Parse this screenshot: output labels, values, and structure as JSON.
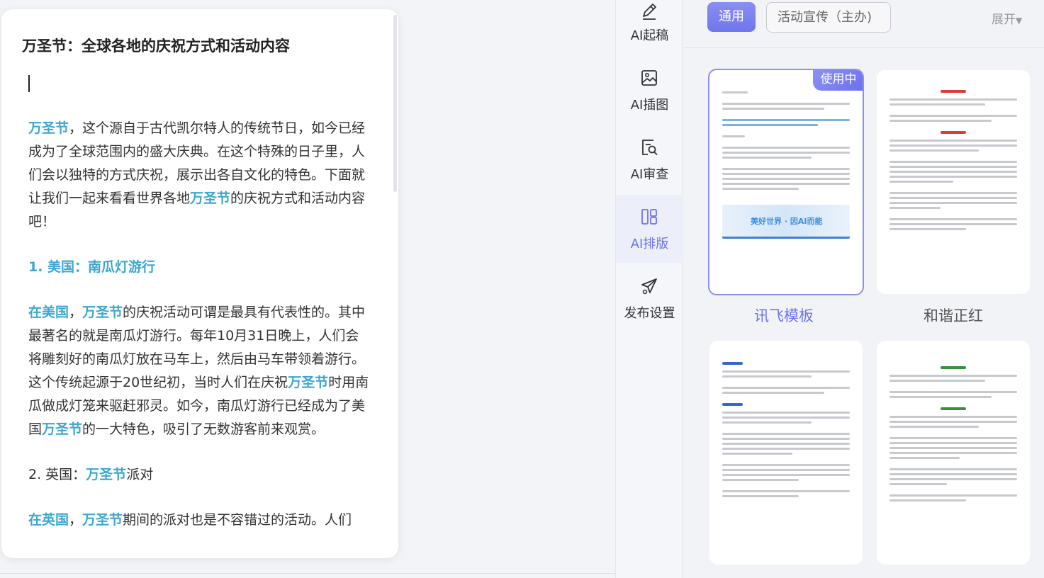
{
  "editor": {
    "title": "万圣节：全球各地的庆祝方式和活动内容",
    "p1": [
      {
        "t": "万圣节",
        "h": true
      },
      {
        "t": "，这个源自于古代凯尔特人的传统节日，如今已经成为了全球范围内的盛大庆典。在这个特殊的日子里，人们会以独特的方式庆祝，展示出各自文化的特色。下面就让我们一起来看看世界各地",
        "h": false
      },
      {
        "t": "万圣节",
        "h": true
      },
      {
        "t": "的庆祝方式和活动内容吧！",
        "h": false
      }
    ],
    "h1": "1. 美国：南瓜灯游行",
    "p2": [
      {
        "t": "在美国",
        "h": true
      },
      {
        "t": "，",
        "h": false
      },
      {
        "t": "万圣节",
        "h": true
      },
      {
        "t": "的庆祝活动可谓是最具有代表性的。其中最著名的就是南瓜灯游行。每年10月31日晚上，人们会将雕刻好的南瓜灯放在马车上，然后由马车带领着游行。这个传统起源于20世纪初，当时人们在庆祝",
        "h": false
      },
      {
        "t": "万圣节",
        "h": true
      },
      {
        "t": "时用南瓜做成灯笼来驱赶邪灵。如今，南瓜灯游行已经成为了美国",
        "h": false
      },
      {
        "t": "万圣节",
        "h": true
      },
      {
        "t": "的一大特色，吸引了无数游客前来观赏。",
        "h": false
      }
    ],
    "h2": [
      {
        "t": "2. 英国：",
        "h": false
      },
      {
        "t": "万圣节",
        "h": true
      },
      {
        "t": "派对",
        "h": false
      }
    ],
    "p3": [
      {
        "t": "在英国",
        "h": true
      },
      {
        "t": "，",
        "h": false
      },
      {
        "t": "万圣节",
        "h": true
      },
      {
        "t": "期间的派对也是不容错过的活动。人们",
        "h": false
      }
    ]
  },
  "tools": [
    {
      "label": "AI起稿",
      "icon": "pen-icon"
    },
    {
      "label": "AI插图",
      "icon": "image-icon"
    },
    {
      "label": "AI审查",
      "icon": "review-icon"
    },
    {
      "label": "AI排版",
      "icon": "layout-icon",
      "active": true
    },
    {
      "label": "发布设置",
      "icon": "send-icon"
    }
  ],
  "panel": {
    "tab_general": "通用",
    "tab_promo": "活动宣传（主办)",
    "expand": "展开",
    "templates": [
      {
        "name": "讯飞模板",
        "badge": "使用中",
        "selected": true
      },
      {
        "name": "和谐正红"
      },
      {
        "name": ""
      },
      {
        "name": ""
      }
    ],
    "banner_text": "美好世界 · 因AI而能"
  },
  "colors": {
    "accent": "#6d74e8",
    "highlight": "#3ea7cf",
    "red_title": "#e03b3b",
    "green_title": "#3a8f3a",
    "blue_title": "#3566c9"
  }
}
